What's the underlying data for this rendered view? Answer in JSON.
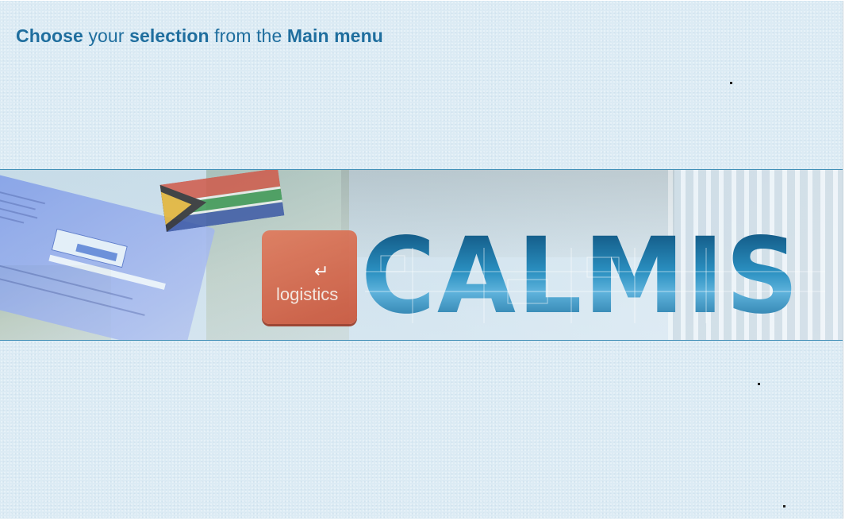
{
  "headline": {
    "part1": "Choose",
    "part2": " your ",
    "part3": "selection",
    "part4": " from the ",
    "part5": "Main menu"
  },
  "banner": {
    "logo_text": "CALMIS",
    "key_label": "logistics",
    "key_arrow_icon": "return-arrow-icon"
  },
  "colors": {
    "background": "#dcebf4",
    "headline": "#1f6e9e",
    "logo": "#1a79a6",
    "rule": "#3f8eb6"
  }
}
